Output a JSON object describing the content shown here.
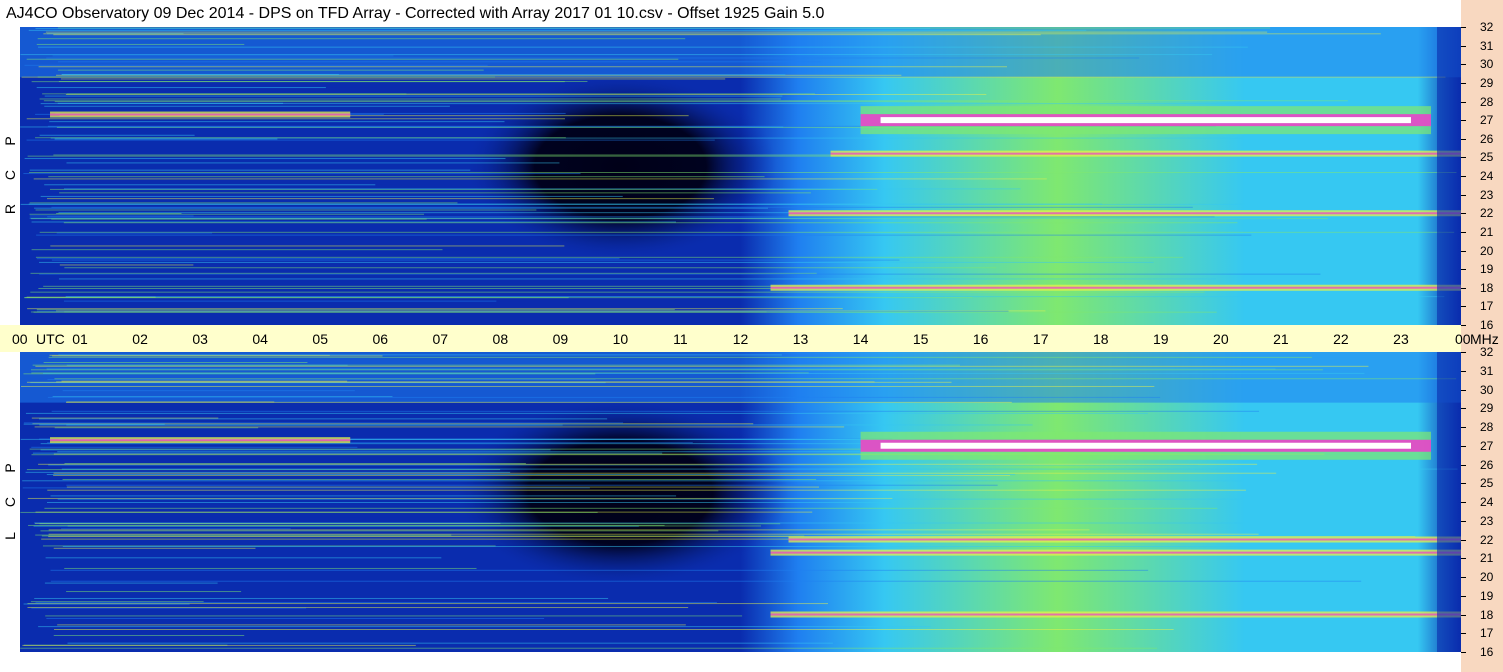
{
  "title": "AJ4CO Observatory  09 Dec 2014  -  DPS on TFD Array  -  Corrected with Array 2017 01 10.csv  -  Offset 1925  Gain 5.0",
  "chart_data": {
    "type": "heatmap",
    "x_axis": {
      "range": [
        0,
        24
      ],
      "tick_labels": [
        "00",
        "01",
        "02",
        "03",
        "04",
        "05",
        "06",
        "07",
        "08",
        "09",
        "10",
        "11",
        "12",
        "13",
        "14",
        "15",
        "16",
        "17",
        "18",
        "19",
        "20",
        "21",
        "22",
        "23",
        "00"
      ],
      "start_unit": "UTC",
      "end_unit": "MHz"
    },
    "y_axis": {
      "range": [
        16,
        32
      ],
      "tick_labels": [
        "32",
        "31",
        "30",
        "29",
        "28",
        "27",
        "26",
        "25",
        "24",
        "23",
        "22",
        "21",
        "20",
        "19",
        "18",
        "17",
        "16"
      ]
    },
    "panels": [
      {
        "name": "R C P",
        "letters": [
          "P",
          "C",
          "R"
        ],
        "features": [
          {
            "type": "dark_region",
            "t_center": 10.0,
            "f_center": 24.5,
            "t_halfwidth": 2.6,
            "f_halfwidth": 5.0
          },
          {
            "type": "strong_band",
            "f": 27.0,
            "t_start": 14.0,
            "t_end": 23.5
          },
          {
            "type": "band",
            "f": 27.3,
            "t_start": 0.5,
            "t_end": 5.5
          },
          {
            "type": "band",
            "f": 18.0,
            "t_start": 12.5,
            "t_end": 24.0
          },
          {
            "type": "band",
            "f": 22.0,
            "t_start": 12.8,
            "t_end": 24.0
          },
          {
            "type": "band",
            "f": 25.2,
            "t_start": 13.5,
            "t_end": 24.0
          }
        ]
      },
      {
        "name": "L C P",
        "letters": [
          "P",
          "C",
          "L"
        ],
        "features": [
          {
            "type": "dark_region",
            "t_center": 10.0,
            "f_center": 24.5,
            "t_halfwidth": 2.8,
            "f_halfwidth": 5.0
          },
          {
            "type": "strong_band",
            "f": 27.0,
            "t_start": 14.0,
            "t_end": 23.5
          },
          {
            "type": "band",
            "f": 27.3,
            "t_start": 0.5,
            "t_end": 5.5
          },
          {
            "type": "band",
            "f": 18.0,
            "t_start": 12.5,
            "t_end": 24.0
          },
          {
            "type": "band",
            "f": 22.0,
            "t_start": 12.8,
            "t_end": 24.0
          },
          {
            "type": "band",
            "f": 21.3,
            "t_start": 12.5,
            "t_end": 24.0
          }
        ]
      }
    ],
    "colors": {
      "deep": "#000018",
      "low": "#0a2cae",
      "mid": "#1f7ff0",
      "cyan": "#36c8f2",
      "green": "#7fe870",
      "yellow": "#e6f24a",
      "magenta": "#f03ccc",
      "white": "#ffffff",
      "axis_band": "#ffffcc",
      "side_strip": "#f8d8c0"
    }
  }
}
